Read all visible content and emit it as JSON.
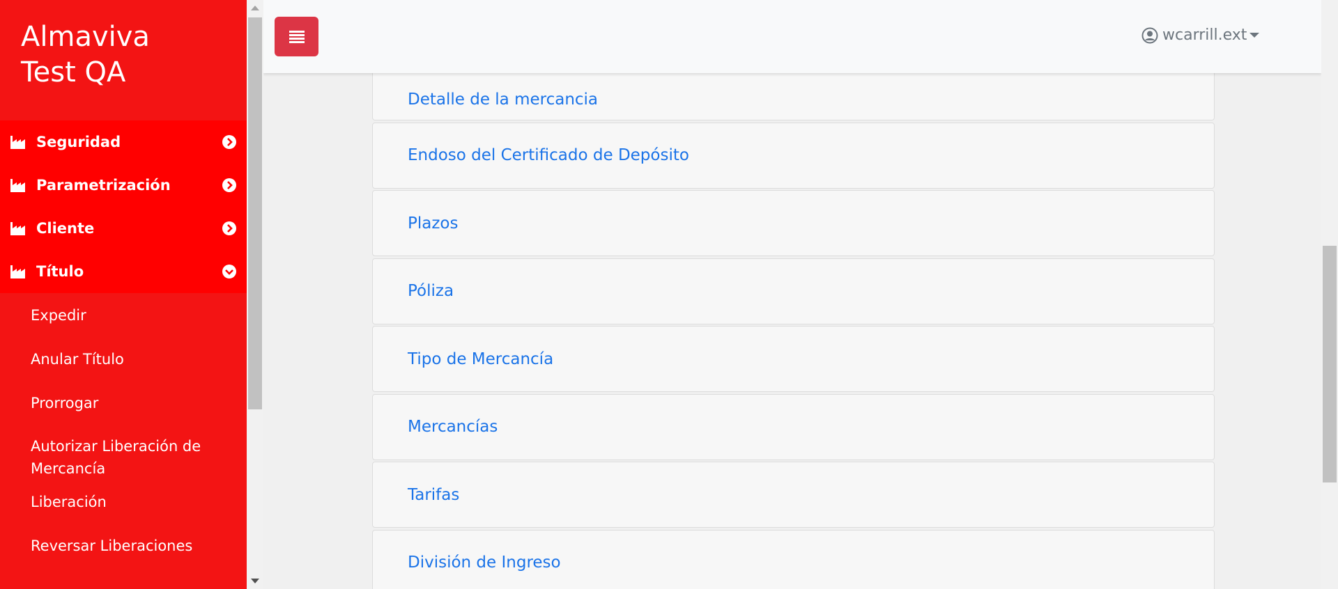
{
  "brand": {
    "line1": "Almaviva",
    "line2": "Test QA"
  },
  "sidebar": {
    "menu": [
      {
        "label": "Seguridad",
        "icon": "factory-icon",
        "chevron": "chevron-right-circle-icon"
      },
      {
        "label": "Parametrización",
        "icon": "factory-icon",
        "chevron": "chevron-right-circle-icon"
      },
      {
        "label": "Cliente",
        "icon": "factory-icon",
        "chevron": "chevron-right-circle-icon"
      },
      {
        "label": "Título",
        "icon": "factory-icon",
        "chevron": "chevron-down-circle-icon"
      }
    ],
    "submenu": [
      {
        "label": "Expedir"
      },
      {
        "label": "Anular Título"
      },
      {
        "label": "Prorrogar"
      },
      {
        "label": "Autorizar Liberación de Mercancía"
      },
      {
        "label": "Liberación"
      },
      {
        "label": "Reversar Liberaciones"
      }
    ]
  },
  "topbar": {
    "toggle_icon": "hamburger-icon",
    "user": {
      "name": "wcarrill.ext",
      "icon": "user-circle-icon"
    }
  },
  "cards": [
    {
      "label": "Detalle de la mercancia"
    },
    {
      "label": "Endoso del Certificado de Depósito"
    },
    {
      "label": "Plazos"
    },
    {
      "label": "Póliza"
    },
    {
      "label": "Tipo de Mercancía"
    },
    {
      "label": "Mercancías"
    },
    {
      "label": "Tarifas"
    },
    {
      "label": "División de Ingreso"
    }
  ],
  "colors": {
    "sidebar_bg": "#f31414",
    "menu_bg": "#ff0000",
    "toggle_bg": "#dc3545",
    "link": "#1a73e8"
  }
}
